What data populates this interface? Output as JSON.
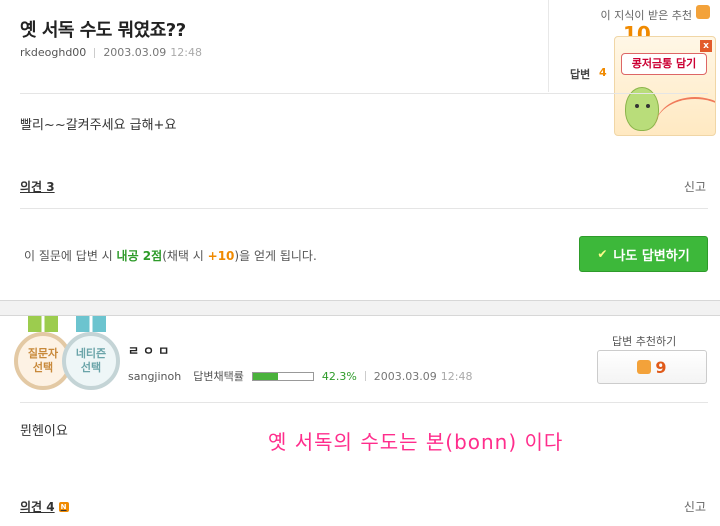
{
  "question": {
    "title": "옛 서독 수도 뭐였죠??",
    "author": "rkdeoghd00",
    "date": "2003.03.09",
    "time": "12:48",
    "body": "빨리~~갈켜주세요 급해+요",
    "recommend_label": "이 지식이 받은 추천",
    "recommend_count_partial": "10",
    "answer_label": "답변",
    "answer_count_partial": "4",
    "opinion_label": "의견 3",
    "report_label": "신고",
    "notice": {
      "prefix": "이 질문에 답변 시 ",
      "points": "내공 2점",
      "middle": "(채택 시 ",
      "bonus": "+10",
      "suffix": ")을 얻게 됩니다."
    },
    "answer_button": "나도 답변하기"
  },
  "ad": {
    "label": "콩저금통 담기",
    "close": "x"
  },
  "answer": {
    "medals": [
      {
        "line1": "질문자",
        "line2": "선택"
      },
      {
        "line1": "네티즌",
        "line2": "선택"
      }
    ],
    "nickname": "ㄹㅇㅁ",
    "user_id": "sangjinoh",
    "adopt_rate_label": "답변채택률",
    "adopt_rate": "42.3%",
    "adopt_rate_value": 42.3,
    "date": "2003.03.09",
    "time": "12:48",
    "recommend_label": "답변 추천하기",
    "recommend_count": "9",
    "body": "뮌헨이요",
    "overlay_caption": "옛 서독의 수도는 본(bonn) 이다",
    "opinion_label": "의견 4",
    "new_badge": "N",
    "report_label": "신고"
  },
  "colors": {
    "accent_green": "#3db83a",
    "accent_orange": "#f08a00",
    "caption_pink": "#ff2d8c"
  }
}
